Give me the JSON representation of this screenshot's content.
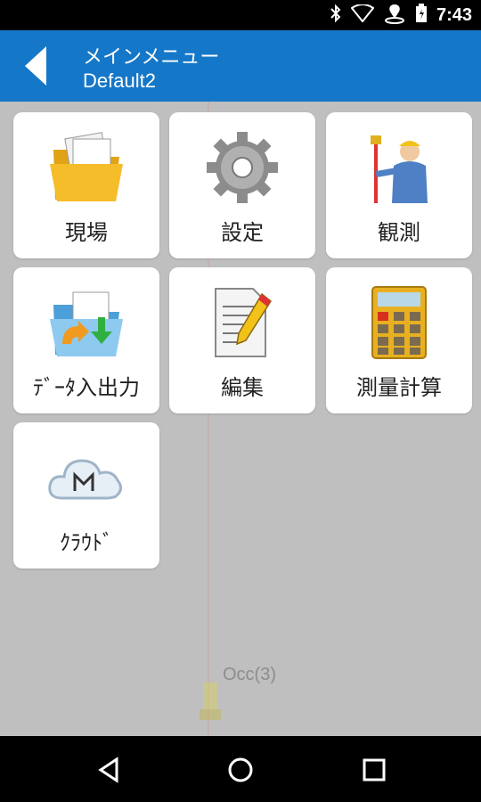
{
  "status_bar": {
    "time": "7:43",
    "icons": [
      "bluetooth-icon",
      "wifi-icon",
      "location-icon",
      "battery-icon"
    ]
  },
  "header": {
    "title": "メインメニュー",
    "subtitle": "Default2"
  },
  "menu": {
    "items": [
      {
        "label": "現場",
        "icon": "folder-icon"
      },
      {
        "label": "設定",
        "icon": "gear-icon"
      },
      {
        "label": "観測",
        "icon": "surveyor-icon"
      },
      {
        "label": "ﾃﾞｰﾀ入出力",
        "icon": "data-transfer-icon"
      },
      {
        "label": "編集",
        "icon": "edit-icon"
      },
      {
        "label": "測量計算",
        "icon": "calculator-icon"
      },
      {
        "label": "ｸﾗｳﾄﾞ",
        "icon": "cloud-icon"
      }
    ]
  },
  "background": {
    "occupied_label": "Occ(3)"
  },
  "colors": {
    "titlebar": "#1577c7",
    "statusbar": "#000000",
    "content_bg": "#bfbfbf"
  }
}
